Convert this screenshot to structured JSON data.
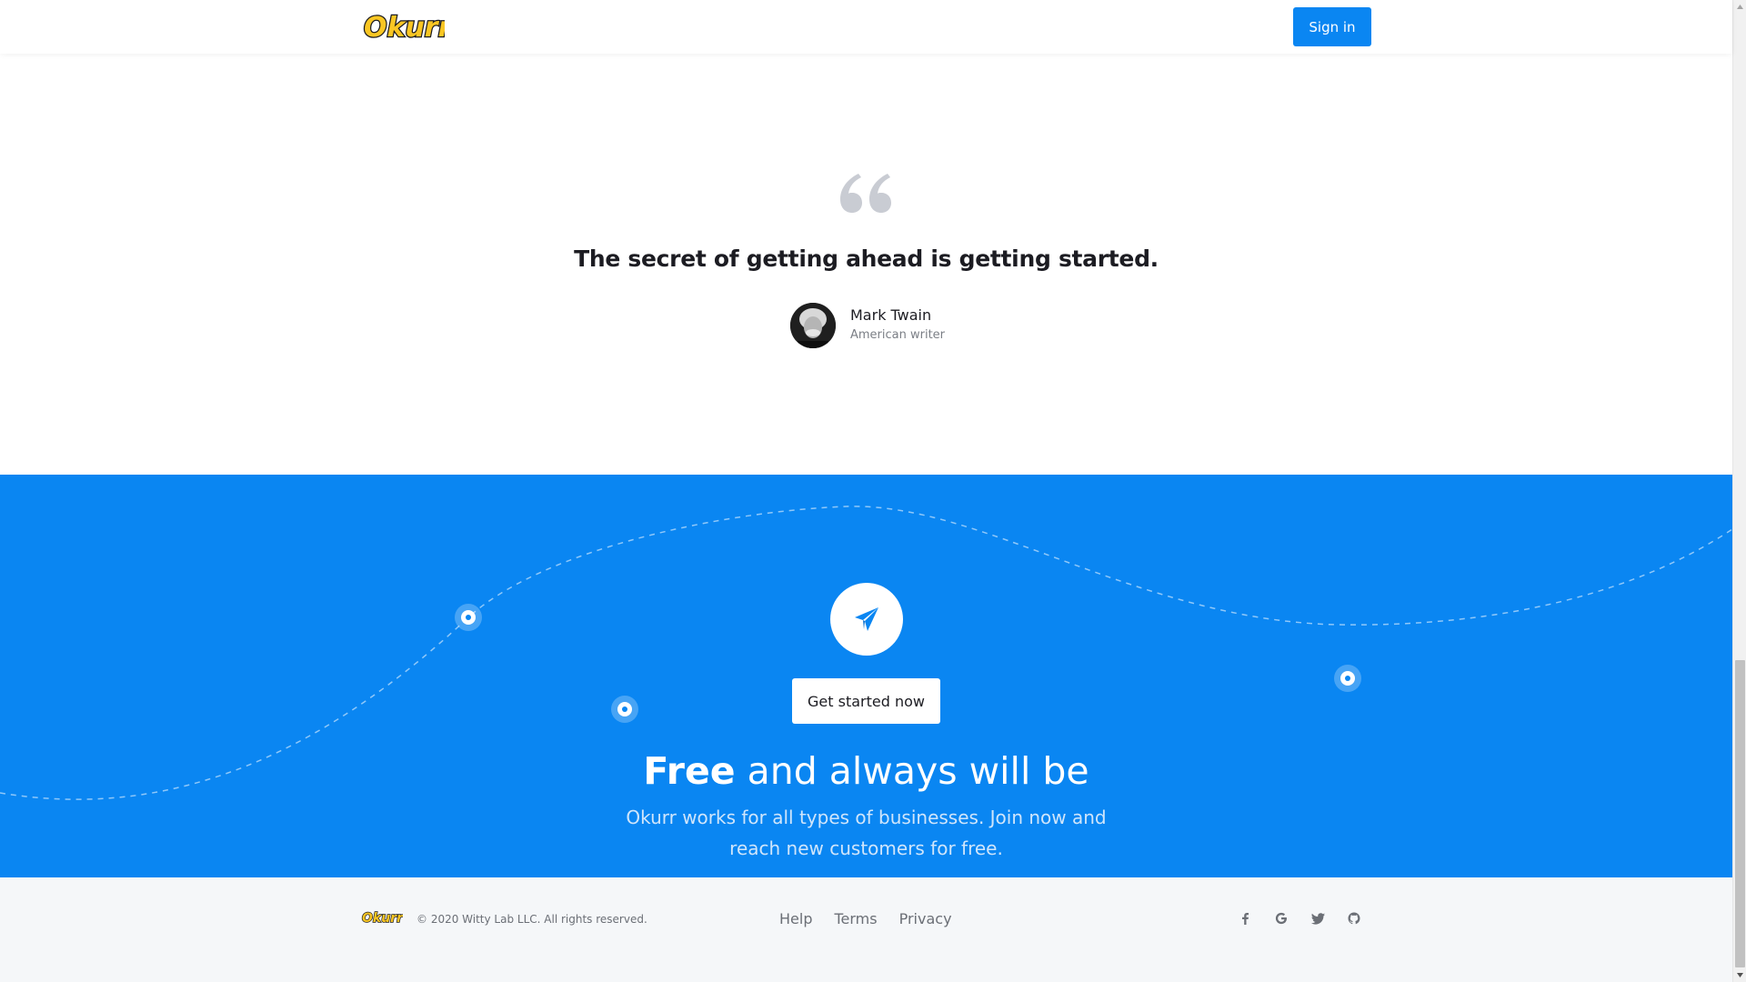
{
  "header": {
    "logo_text": "Okurr",
    "signin_label": "Sign in"
  },
  "quote": {
    "text": "The secret of getting ahead is getting started.",
    "author_name": "Mark Twain",
    "author_role": "American writer"
  },
  "cta": {
    "button_label": "Get started now",
    "heading_bold": "Free",
    "heading_rest": " and always will be",
    "subtitle": "Okurr works for all types of businesses. Join now and reach new customers for free."
  },
  "footer": {
    "logo_text": "Okurr",
    "copyright": "© 2020 Witty Lab LLC. All rights reserved.",
    "links": [
      "Help",
      "Terms",
      "Privacy"
    ],
    "social": [
      "facebook-icon",
      "google-icon",
      "twitter-icon",
      "github-icon"
    ]
  },
  "colors": {
    "brand_blue": "#0a86f2",
    "logo_yellow": "#f9c623",
    "footer_bg": "#f5f7f9"
  }
}
